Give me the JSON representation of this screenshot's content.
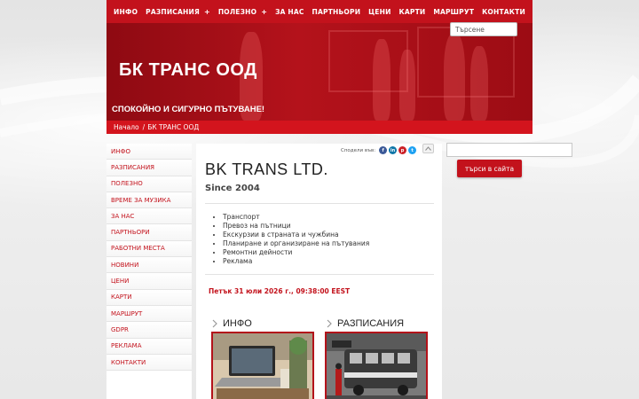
{
  "nav": {
    "items": [
      {
        "label": "ИНФО",
        "has_plus": false
      },
      {
        "label": "РАЗПИСАНИЯ",
        "has_plus": true
      },
      {
        "label": "ПОЛЕЗНО",
        "has_plus": true
      },
      {
        "label": "ЗА НАС",
        "has_plus": false
      },
      {
        "label": "ПАРТНЬОРИ",
        "has_plus": false
      },
      {
        "label": "ЦЕНИ",
        "has_plus": false
      },
      {
        "label": "КАРТИ",
        "has_plus": false
      },
      {
        "label": "МАРШРУТ",
        "has_plus": false
      },
      {
        "label": "КОНТАКТИ",
        "has_plus": false
      }
    ],
    "plus_glyph": "+"
  },
  "search": {
    "placeholder": "Търсене"
  },
  "banner": {
    "title": "БК ТРАНС ООД",
    "subtitle": "СПОКОЙНО И СИГУРНО ПЪТУВАНЕ!"
  },
  "breadcrumb": {
    "home": "Начало",
    "separator": "/",
    "current": "БК ТРАНС ООД"
  },
  "sidebar": {
    "items": [
      {
        "label": "ИНФО"
      },
      {
        "label": "РАЗПИСАНИЯ"
      },
      {
        "label": "ПОЛЕЗНО"
      },
      {
        "label": "ВРЕМЕ ЗА МУЗИКА"
      },
      {
        "label": "ЗА НАС"
      },
      {
        "label": "ПАРТНЬОРИ"
      },
      {
        "label": "РАБОТНИ МЕСТА"
      },
      {
        "label": "НОВИНИ"
      },
      {
        "label": "ЦЕНИ"
      },
      {
        "label": "КАРТИ"
      },
      {
        "label": "МАРШРУТ"
      },
      {
        "label": "GDPR"
      },
      {
        "label": "РЕКЛАМА"
      },
      {
        "label": "КОНТАКТИ"
      }
    ]
  },
  "main": {
    "share_label": "Сподели във:",
    "share_icons": [
      {
        "name": "facebook-icon",
        "glyph": "f",
        "color": "#3b5998"
      },
      {
        "name": "linkedin-icon",
        "glyph": "in",
        "color": "#0e76a8"
      },
      {
        "name": "pinterest-icon",
        "glyph": "p",
        "color": "#cb2027"
      },
      {
        "name": "twitter-icon",
        "glyph": "t",
        "color": "#1da1f2"
      }
    ],
    "title": "BK TRANS LTD.",
    "since": "Since 2004",
    "services": [
      "Транспорт",
      "Превоз на пътници",
      "Екскурзии в страната и чужбина",
      "Планиране и организиране на пътувания",
      "Ремонтни дейности",
      "Реклама"
    ],
    "datetime": "Петък 31 юли 2026 г., 09:38:00 EEST",
    "cards": [
      {
        "title": "ИНФО",
        "image": "laptop-desk-photo"
      },
      {
        "title": "РАЗПИСАНИЯ",
        "image": "vintage-bus-stop-photo"
      }
    ]
  },
  "right": {
    "search_button": "търси в сайта"
  },
  "colors": {
    "brand_red": "#c3121c",
    "dark_red": "#8e0a12",
    "background": "#e9e9e9"
  }
}
